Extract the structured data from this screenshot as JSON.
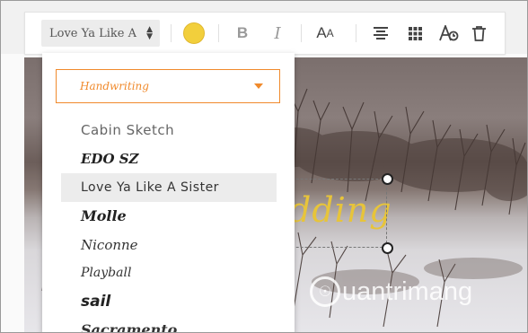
{
  "toolbar": {
    "font_value": "Love Ya Like A Sister",
    "text_color": "#f2cf3c",
    "icons": [
      "bold-icon",
      "italic-icon",
      "font-size-icon",
      "align-center-icon",
      "grid-icon",
      "text-effect-icon",
      "trash-icon"
    ]
  },
  "dropdown": {
    "category": "Handwriting",
    "fonts": [
      {
        "label": "Cabin Sketch"
      },
      {
        "label": "EDO SZ"
      },
      {
        "label": "Love Ya Like A Sister",
        "selected": true
      },
      {
        "label": "Molle"
      },
      {
        "label": "Niconne"
      },
      {
        "label": "Playball"
      },
      {
        "label": "sail"
      },
      {
        "label": "Sacramento"
      }
    ]
  },
  "canvas": {
    "text": "dding",
    "watermark": "uantrimang"
  }
}
